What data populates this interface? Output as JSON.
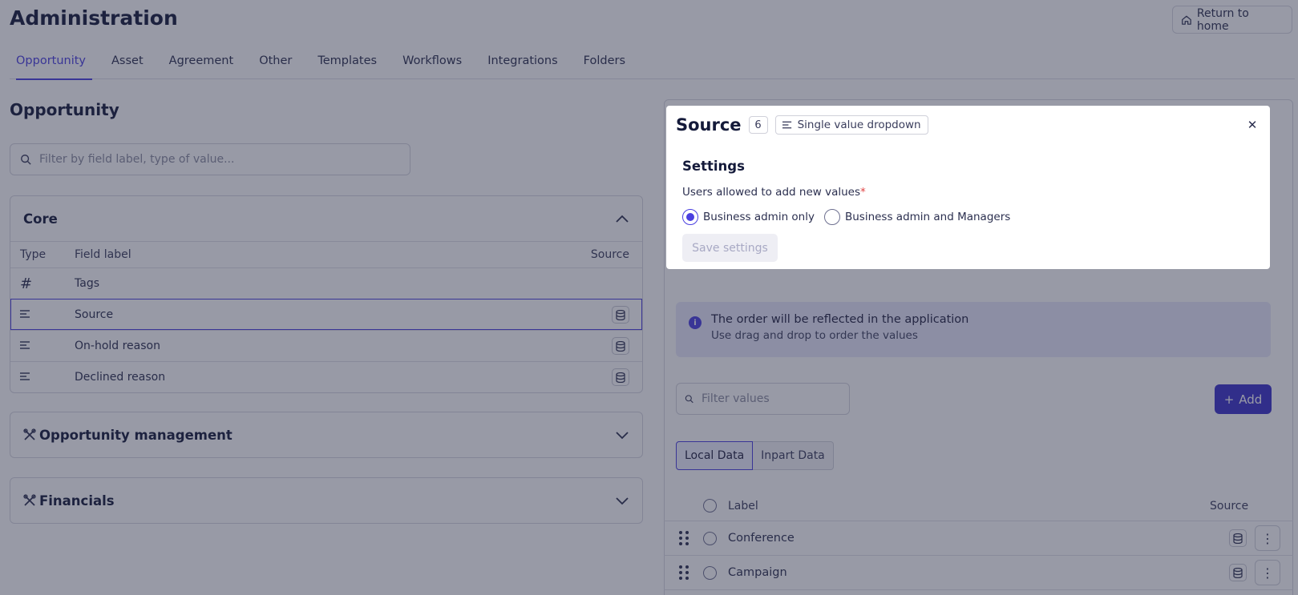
{
  "header": {
    "title": "Administration",
    "return_home": "Return to home"
  },
  "tabs": [
    "Opportunity",
    "Asset",
    "Agreement",
    "Other",
    "Templates",
    "Workflows",
    "Integrations",
    "Folders"
  ],
  "left": {
    "section_title": "Opportunity",
    "filter_placeholder": "Filter by field label, type of value...",
    "core": {
      "title": "Core",
      "columns": {
        "type": "Type",
        "label": "Field label",
        "source": "Source"
      },
      "rows": [
        {
          "type_icon": "#",
          "label": "Tags"
        },
        {
          "type_icon": "list-icon",
          "label": "Source"
        },
        {
          "type_icon": "list-icon",
          "label": "On-hold reason"
        },
        {
          "type_icon": "list-icon",
          "label": "Declined reason"
        }
      ]
    },
    "groups": [
      {
        "title": "Opportunity management"
      },
      {
        "title": "Financials"
      }
    ]
  },
  "right": {
    "info": {
      "line1": "The order will be reflected in the application",
      "line2": "Use drag and drop to order the values"
    },
    "filter_placeholder": "Filter values",
    "add_label": "Add",
    "segments": [
      "Local Data",
      "Inpart Data"
    ],
    "columns": {
      "label": "Label",
      "source": "Source"
    },
    "values": [
      "Conference",
      "Campaign"
    ]
  },
  "modal": {
    "title": "Source",
    "count": "6",
    "type_label": "Single value dropdown",
    "settings_title": "Settings",
    "field_label": "Users allowed to add new values",
    "required_mark": "*",
    "options": [
      "Business admin only",
      "Business admin and Managers"
    ],
    "selected_option": "Business admin only",
    "save_label": "Save settings"
  },
  "colors": {
    "accent": "#4a3fe0",
    "add_button": "#3b31c9",
    "overlay": "#282c44",
    "info_bg": "#e8e9fb",
    "required": "#e04545"
  }
}
